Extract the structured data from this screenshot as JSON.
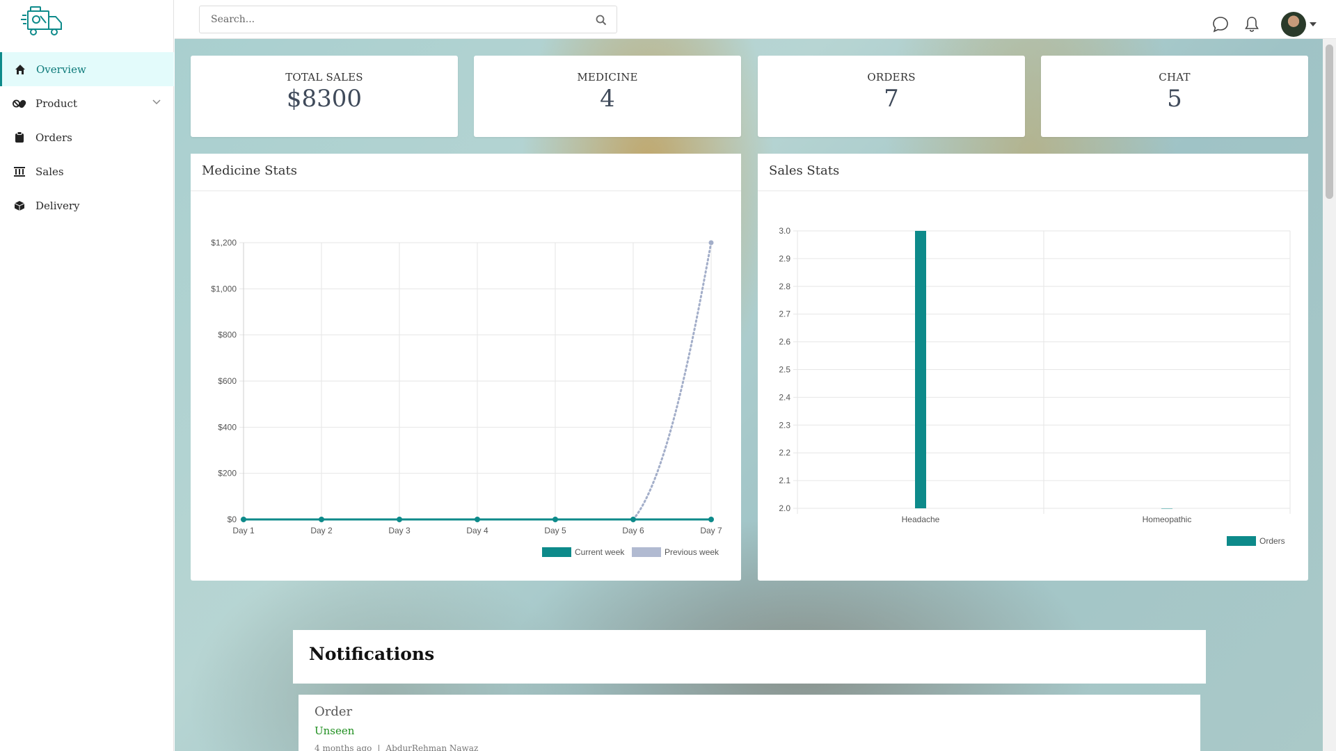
{
  "colors": {
    "accent": "#0d8a8a",
    "active_bg": "#e3fbfb",
    "previous_week": "#a3aec9",
    "unseen": "#1e8e1e"
  },
  "sidebar": {
    "items": [
      {
        "label": "Overview",
        "icon": "home-icon",
        "active": true
      },
      {
        "label": "Product",
        "icon": "pills-icon",
        "expandable": true
      },
      {
        "label": "Orders",
        "icon": "clipboard-icon"
      },
      {
        "label": "Sales",
        "icon": "bank-icon"
      },
      {
        "label": "Delivery",
        "icon": "box-icon"
      }
    ]
  },
  "header": {
    "search_placeholder": "Search...",
    "icons": [
      "chat-icon",
      "bell-icon"
    ]
  },
  "stats": [
    {
      "label": "TOTAL SALES",
      "value": "$8300"
    },
    {
      "label": "MEDICINE",
      "value": "4"
    },
    {
      "label": "ORDERS",
      "value": "7"
    },
    {
      "label": "CHAT",
      "value": "5"
    }
  ],
  "panels": {
    "medicine_title": "Medicine Stats",
    "sales_title": "Sales Stats"
  },
  "chart_data": [
    {
      "type": "line",
      "title": "Medicine Stats",
      "categories": [
        "Day 1",
        "Day 2",
        "Day 3",
        "Day 4",
        "Day 5",
        "Day 6",
        "Day 7"
      ],
      "y_ticks": [
        "$0",
        "$200",
        "$400",
        "$600",
        "$800",
        "$1,000",
        "$1,200"
      ],
      "ylim": [
        0,
        1200
      ],
      "series": [
        {
          "name": "Current week",
          "values": [
            0,
            0,
            0,
            0,
            0,
            0,
            0
          ],
          "color": "#0d8a8a",
          "style": "solid"
        },
        {
          "name": "Previous week",
          "values": [
            null,
            null,
            null,
            null,
            null,
            0,
            1200
          ],
          "color": "#a3aec9",
          "style": "dotted"
        }
      ],
      "grid": true,
      "legend": "bottom-right"
    },
    {
      "type": "bar",
      "title": "Sales Stats",
      "categories": [
        "Headache",
        "Homeopathic"
      ],
      "y_ticks": [
        "2.0",
        "2.1",
        "2.2",
        "2.3",
        "2.4",
        "2.5",
        "2.6",
        "2.7",
        "2.8",
        "2.9",
        "3.0"
      ],
      "ylim": [
        2.0,
        3.0
      ],
      "series": [
        {
          "name": "Orders",
          "values": [
            3,
            2
          ],
          "color": "#0d8a8a"
        }
      ],
      "grid": true,
      "legend": "bottom-right"
    }
  ],
  "notifications": {
    "title": "Notifications",
    "items": [
      {
        "type": "Order",
        "status": "Unseen",
        "time": "4 months ago",
        "separator": "|",
        "author": "AbdurRehman Nawaz"
      }
    ]
  }
}
